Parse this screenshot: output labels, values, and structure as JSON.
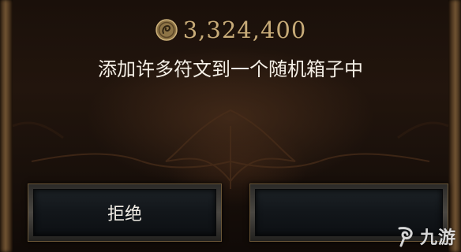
{
  "dialog": {
    "cost_value": "3,324,400",
    "message": "添加许多符文到一个随机箱子中",
    "currency_icon": "gold-coin-icon"
  },
  "buttons": {
    "reject_label": "拒绝",
    "accept_label": ""
  },
  "watermark": {
    "text": "九游"
  },
  "colors": {
    "cost_text": "#c7ab78",
    "message_text": "#f4efe6",
    "frame_gold": "#6f5232"
  }
}
